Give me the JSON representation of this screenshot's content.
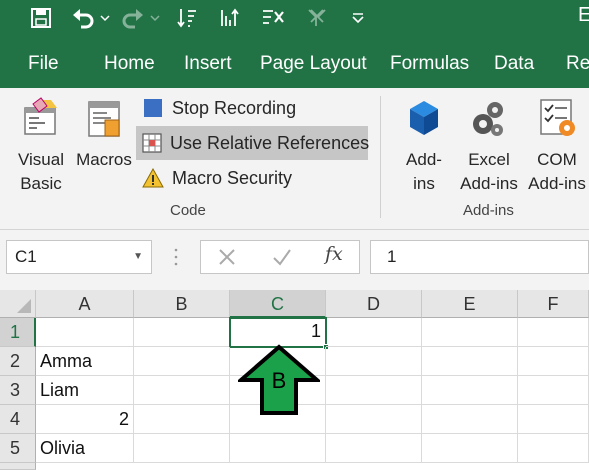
{
  "window": {
    "title_fragment": "E"
  },
  "colors": {
    "accent": "#217346",
    "arrow_fill": "#1aa14a",
    "arrow_stroke": "#000000"
  },
  "qat": {
    "icons": [
      "save-icon",
      "undo-icon",
      "undo-dropdown-icon",
      "redo-icon",
      "redo-dropdown-icon",
      "sort-asc-icon",
      "sort-desc-icon",
      "clear-filter-icon",
      "filter-icon",
      "customize-qat-icon"
    ]
  },
  "menu": {
    "tabs": [
      {
        "label": "File"
      },
      {
        "label": "Home"
      },
      {
        "label": "Insert"
      },
      {
        "label": "Page Layout"
      },
      {
        "label": "Formulas"
      },
      {
        "label": "Data"
      },
      {
        "label": "Rev"
      }
    ]
  },
  "ribbon": {
    "code_group": {
      "label": "Code",
      "visual_basic": {
        "line1": "Visual",
        "line2": "Basic"
      },
      "macros": {
        "label": "Macros"
      },
      "stop_recording": {
        "label": "Stop Recording"
      },
      "use_relative": {
        "label": "Use Relative References"
      },
      "macro_security": {
        "label": "Macro Security"
      }
    },
    "addins_group": {
      "label": "Add-ins",
      "addins": {
        "line1": "Add-",
        "line2": "ins"
      },
      "excel_addins": {
        "line1": "Excel",
        "line2": "Add-ins"
      },
      "com_addins": {
        "line1": "COM",
        "line2": "Add-ins"
      }
    }
  },
  "formula_bar": {
    "name_box": "C1",
    "fx_label": "fx",
    "value": "1"
  },
  "sheet": {
    "columns": [
      "A",
      "B",
      "C",
      "D",
      "E",
      "F"
    ],
    "selected_column": "C",
    "rows": [
      {
        "num": "1",
        "A": "",
        "B": "",
        "C": "1"
      },
      {
        "num": "2",
        "A": "Amma",
        "B": "",
        "C": ""
      },
      {
        "num": "3",
        "A": "Liam",
        "B": "",
        "C": ""
      },
      {
        "num": "4",
        "A": "2",
        "B": "",
        "C": ""
      },
      {
        "num": "5",
        "A": "Olivia",
        "B": "",
        "C": ""
      }
    ]
  },
  "annotation": {
    "label": "B"
  }
}
